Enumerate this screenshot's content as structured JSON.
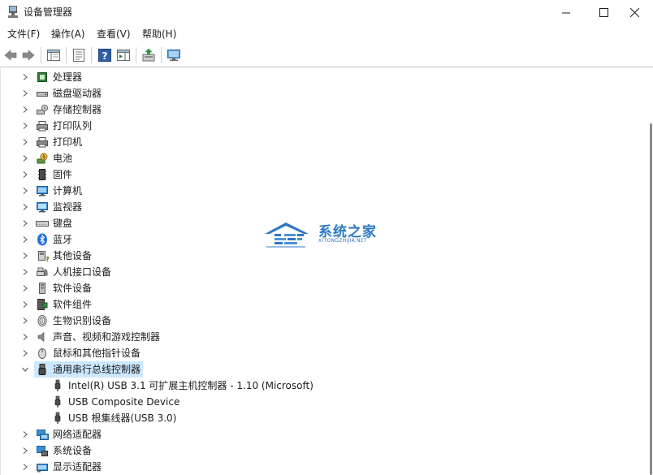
{
  "window": {
    "title": "设备管理器"
  },
  "menu": {
    "items": [
      "文件(F)",
      "操作(A)",
      "查看(V)",
      "帮助(H)"
    ]
  },
  "tree": {
    "categories": [
      {
        "label": "处理器",
        "icon": "processor-icon"
      },
      {
        "label": "磁盘驱动器",
        "icon": "disk-drive-icon"
      },
      {
        "label": "存储控制器",
        "icon": "storage-controller-icon"
      },
      {
        "label": "打印队列",
        "icon": "print-queue-icon"
      },
      {
        "label": "打印机",
        "icon": "printer-icon"
      },
      {
        "label": "电池",
        "icon": "battery-icon"
      },
      {
        "label": "固件",
        "icon": "firmware-icon"
      },
      {
        "label": "计算机",
        "icon": "computer-icon"
      },
      {
        "label": "监视器",
        "icon": "monitor-icon"
      },
      {
        "label": "键盘",
        "icon": "keyboard-icon"
      },
      {
        "label": "蓝牙",
        "icon": "bluetooth-icon"
      },
      {
        "label": "其他设备",
        "icon": "other-devices-icon"
      },
      {
        "label": "人机接口设备",
        "icon": "hid-icon"
      },
      {
        "label": "软件设备",
        "icon": "software-device-icon"
      },
      {
        "label": "软件组件",
        "icon": "software-component-icon"
      },
      {
        "label": "生物识别设备",
        "icon": "biometric-icon"
      },
      {
        "label": "声音、视频和游戏控制器",
        "icon": "audio-icon"
      },
      {
        "label": "鼠标和其他指针设备",
        "icon": "mouse-icon"
      },
      {
        "label": "通用串行总线控制器",
        "icon": "usb-controller-icon",
        "expanded": true,
        "selected": true
      },
      {
        "label": "网络适配器",
        "icon": "network-adapter-icon"
      },
      {
        "label": "系统设备",
        "icon": "system-device-icon"
      },
      {
        "label": "显示适配器",
        "icon": "display-adapter-icon"
      }
    ],
    "usb_children": [
      {
        "label": "Intel(R) USB 3.1 可扩展主机控制器 - 1.10 (Microsoft)",
        "icon": "usb-plug-icon"
      },
      {
        "label": "USB Composite Device",
        "icon": "usb-plug-icon"
      },
      {
        "label": "USB 根集线器(USB 3.0)",
        "icon": "usb-plug-icon"
      }
    ]
  },
  "watermark": {
    "title": "系统之家",
    "subtitle": "XITONGZHIJIA.NET"
  },
  "colors": {
    "selection": "#cce8ff",
    "accent": "#2c78c4"
  }
}
